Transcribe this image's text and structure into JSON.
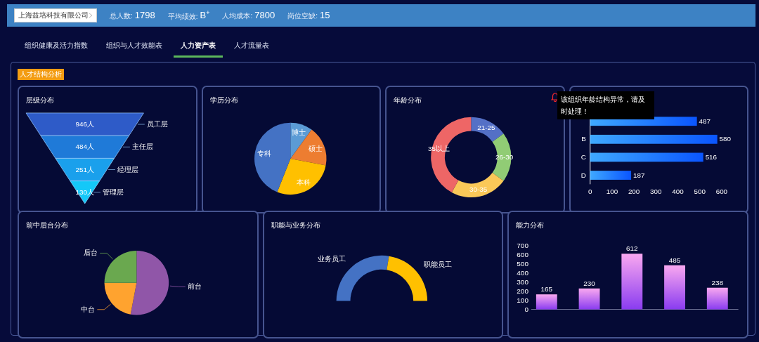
{
  "header": {
    "company": "上海益培科技有限公司",
    "stats": [
      {
        "label": "总人数:",
        "value": "1798"
      },
      {
        "label": "平均绩效:",
        "value": "B$^{+}$"
      },
      {
        "label": "人均成本:",
        "value": "7800"
      },
      {
        "label": "岗位空缺:",
        "value": "15"
      }
    ]
  },
  "tabs": [
    {
      "label": "组织健康及活力指数",
      "selected": false
    },
    {
      "label": "组织与人才效能表",
      "selected": false
    },
    {
      "label": "人力资产表",
      "selected": true
    },
    {
      "label": "人才流量表",
      "selected": false
    }
  ],
  "section_tag": "人才结构分析",
  "panels": [
    {
      "title": "层级分布",
      "kind": "funnel",
      "levels": [
        {
          "label": "员工层",
          "count": "946人"
        },
        {
          "label": "主任层",
          "count": "484人"
        },
        {
          "label": "经理层",
          "count": "251人"
        },
        {
          "label": "管理层",
          "count": "130人"
        }
      ]
    },
    {
      "title": "学历分布",
      "kind": "pie",
      "chart_data": {
        "type": "pie",
        "categories": [
          "博士",
          "硕士",
          "本科",
          "专科"
        ],
        "values": [
          10,
          18,
          28,
          44
        ],
        "colors": [
          "#5b9bd5",
          "#ed7d31",
          "#ffc000",
          "#4472c4"
        ]
      }
    },
    {
      "title": "年龄分布",
      "kind": "donut",
      "alert": {
        "message": "该组织年龄结构异常，请及时处理！"
      },
      "chart_data": {
        "type": "donut",
        "categories": [
          "21-25",
          "26-30",
          "30-35",
          "35以上"
        ],
        "values": [
          15,
          20,
          23,
          42
        ],
        "colors": [
          "#5470c6",
          "#91cc75",
          "#fac858",
          "#ee6666"
        ]
      }
    },
    {
      "kind": "hbar",
      "chart_data": {
        "type": "bar",
        "orientation": "horizontal",
        "categories": [
          null,
          "B",
          "C",
          "D"
        ],
        "values": [
          487,
          580,
          516,
          187
        ],
        "xlim": [
          0,
          600
        ],
        "xticks": [
          0,
          100,
          200,
          300,
          400,
          500,
          600
        ],
        "data_labels": true
      }
    },
    {
      "title": "前中后台分布",
      "kind": "pie-outside",
      "chart_data": {
        "type": "pie",
        "categories": [
          "前台",
          "中台",
          "后台"
        ],
        "values": [
          53,
          22,
          25
        ],
        "colors": [
          "#9056a8",
          "#ffa32f",
          "#6aa84f"
        ]
      }
    },
    {
      "title": "职能与业务分布",
      "kind": "half-donut",
      "chart_data": {
        "type": "donut",
        "categories": [
          "业务员工",
          "职能员工"
        ],
        "values": [
          55,
          45
        ],
        "colors": [
          "#4472c4",
          "#ffc000"
        ]
      }
    },
    {
      "title": "能力分布",
      "kind": "vbar",
      "chart_data": {
        "type": "bar",
        "values": [
          165,
          230,
          612,
          485,
          238
        ],
        "ylim": [
          0,
          700
        ],
        "yticks": [
          0,
          100,
          200,
          300,
          400,
          500,
          600,
          700
        ],
        "data_labels": true
      }
    }
  ]
}
